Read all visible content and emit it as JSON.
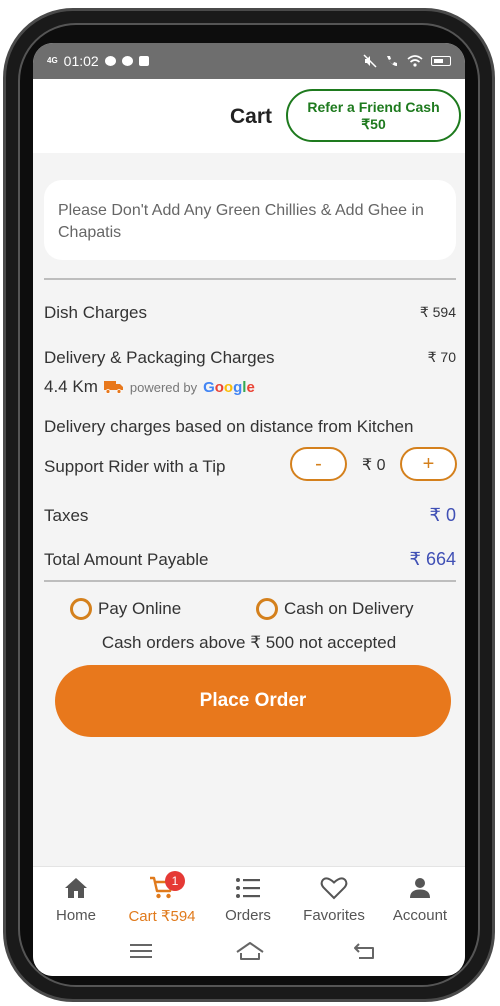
{
  "status_bar": {
    "network": "4G",
    "time": "01:02",
    "battery": "61"
  },
  "header": {
    "title": "Cart",
    "refer_line1": "Refer a Friend Cash",
    "refer_line2": "₹50"
  },
  "note": {
    "text": "Please Don't Add Any Green Chillies & Add Ghee in Chapatis"
  },
  "charges": {
    "dish_label": "Dish Charges",
    "dish_value": "₹ 594",
    "delivery_label": "Delivery & Packaging Charges",
    "delivery_value": "₹ 70",
    "distance": "4.4 Km",
    "powered_by": "powered by",
    "google": "Google",
    "delivery_note": "Delivery charges based on distance from Kitchen",
    "tip_label": "Support Rider with a Tip",
    "tip_minus": "-",
    "tip_value": "₹ 0",
    "tip_plus": "+",
    "taxes_label": "Taxes",
    "taxes_value": "₹ 0",
    "total_label": "Total Amount Payable",
    "total_value": "₹ 664"
  },
  "payment": {
    "online_label": "Pay Online",
    "cod_label": "Cash on Delivery",
    "cash_note": "Cash orders above ₹ 500 not accepted",
    "place_order": "Place Order"
  },
  "bottom_nav": {
    "home": "Home",
    "cart": "Cart ₹594",
    "cart_badge": "1",
    "orders": "Orders",
    "favorites": "Favorites",
    "account": "Account"
  },
  "colors": {
    "accent": "#e8781c",
    "green": "#1e7a1e",
    "blue": "#4050b5"
  }
}
